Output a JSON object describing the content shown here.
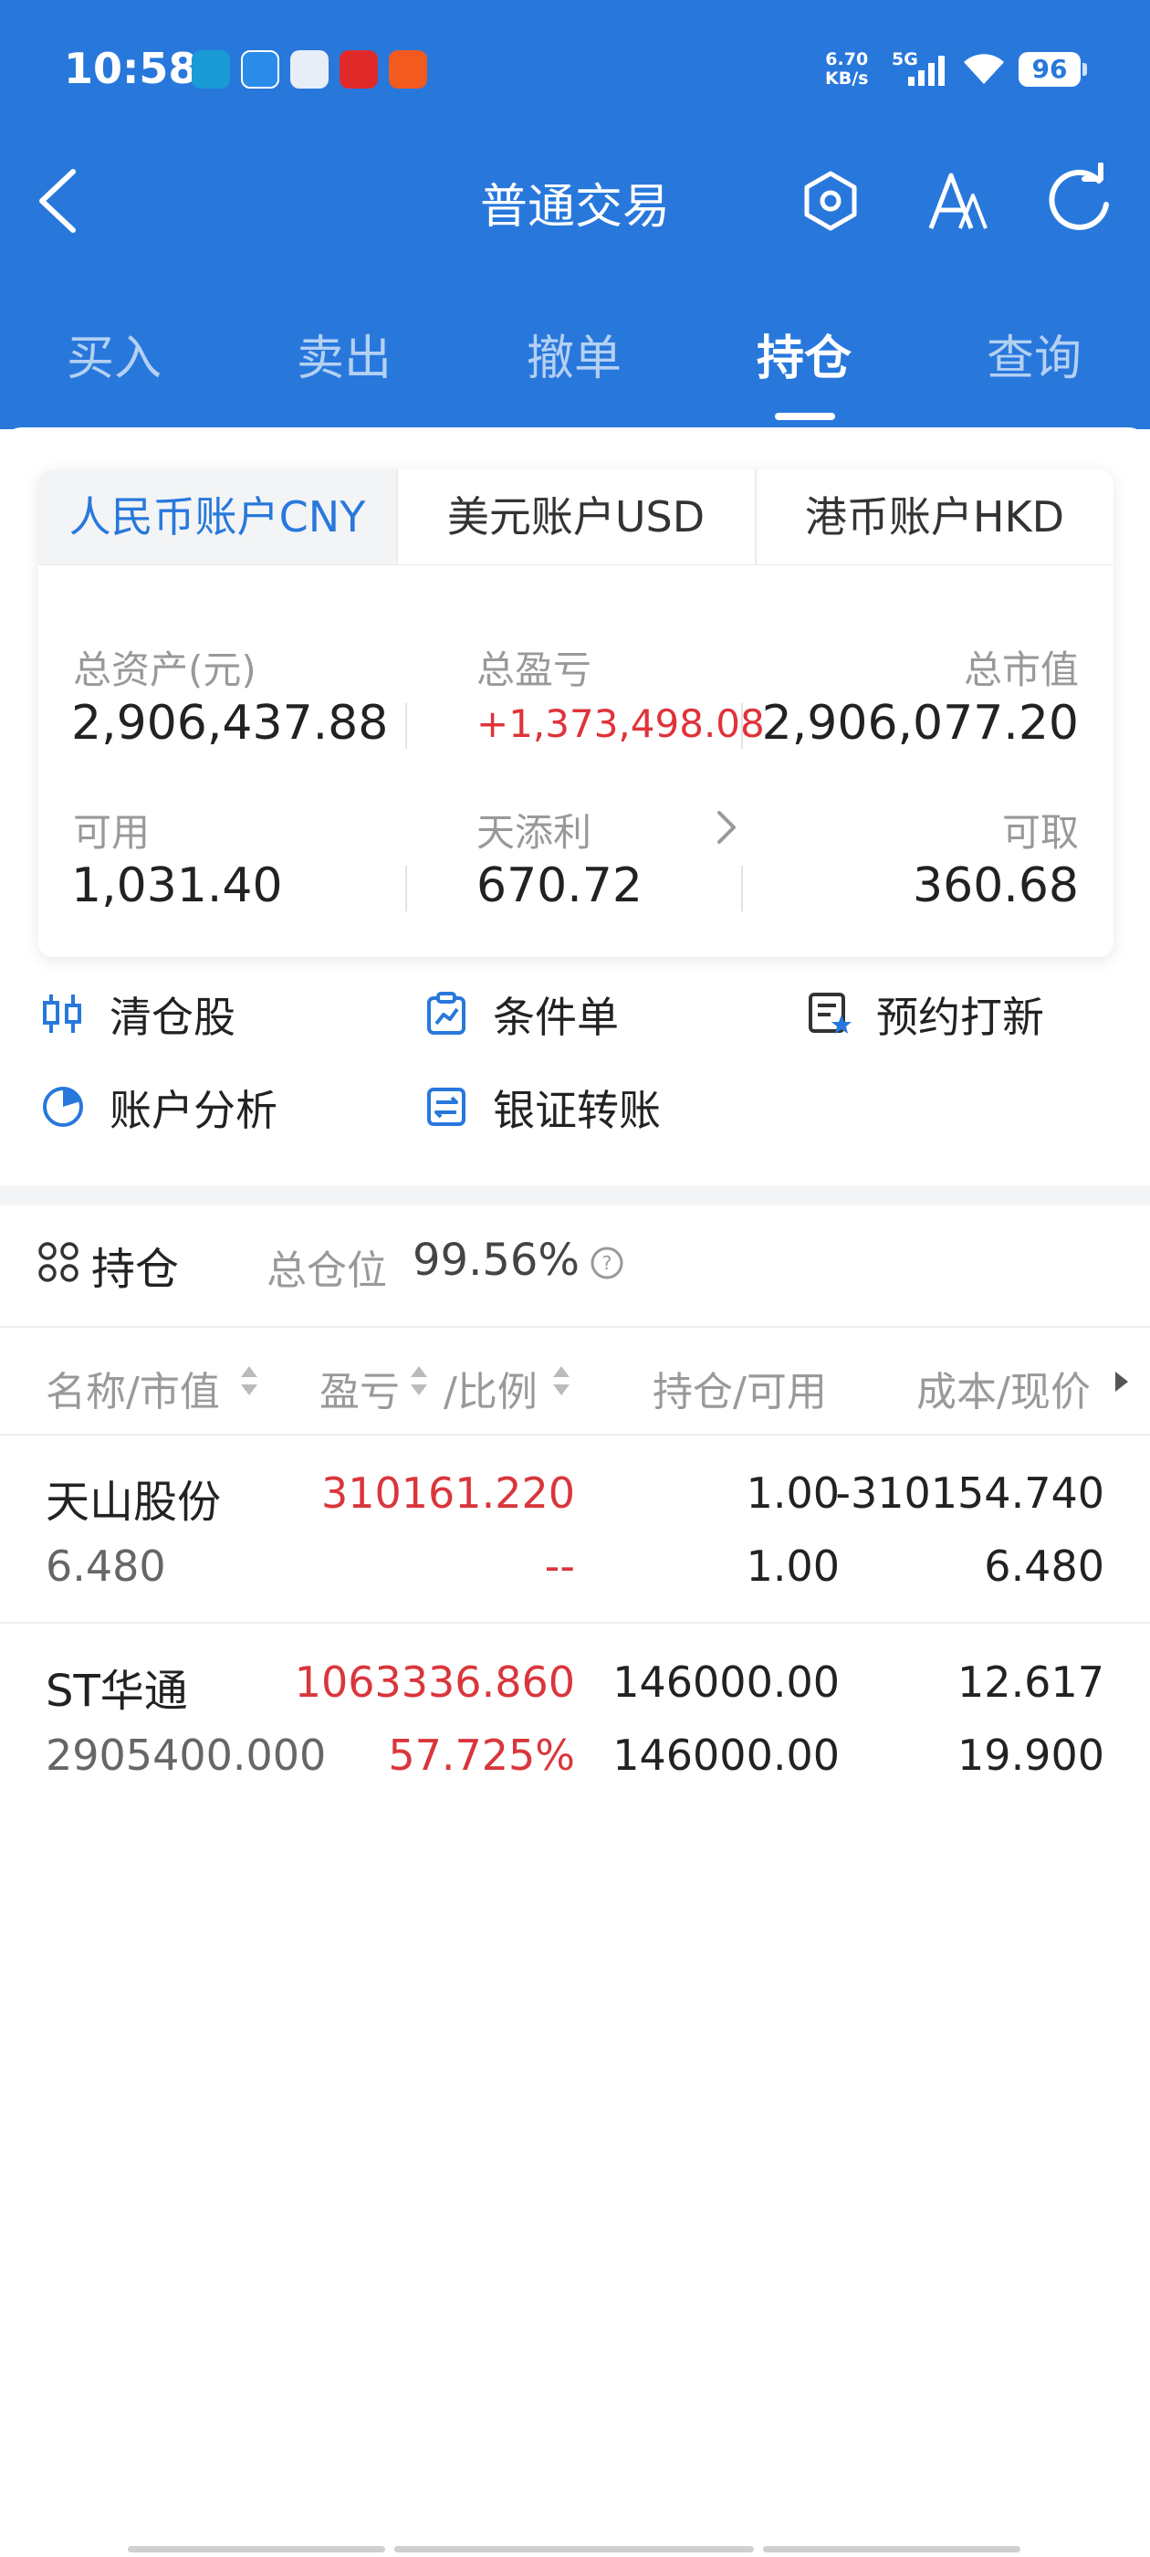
{
  "status_bar": {
    "time": "10:58",
    "net_speed_value": "6.70",
    "net_speed_unit": "KB/s",
    "network": "5G",
    "battery": "96"
  },
  "nav": {
    "title": "普通交易"
  },
  "tabs": [
    {
      "label": "买入"
    },
    {
      "label": "卖出"
    },
    {
      "label": "撤单"
    },
    {
      "label": "持仓"
    },
    {
      "label": "查询"
    }
  ],
  "account_tabs": [
    {
      "label": "人民币账户CNY"
    },
    {
      "label": "美元账户USD"
    },
    {
      "label": "港币账户HKD"
    }
  ],
  "summary": {
    "total_assets_label": "总资产(元)",
    "total_assets_value": "2,906,437.88",
    "total_pnl_label": "总盈亏",
    "total_pnl_value": "+1,373,498.08",
    "market_value_label": "总市值",
    "market_value_value": "2,906,077.20",
    "available_label": "可用",
    "available_value": "1,031.40",
    "tiantianli_label": "天添利",
    "tiantianli_value": "670.72",
    "withdrawable_label": "可取",
    "withdrawable_value": "360.68"
  },
  "quick_actions": [
    {
      "label": "清仓股"
    },
    {
      "label": "条件单"
    },
    {
      "label": "预约打新"
    },
    {
      "label": "账户分析"
    },
    {
      "label": "银证转账"
    }
  ],
  "holdings": {
    "title": "持仓",
    "position_ratio_label": "总仓位",
    "position_ratio_value": "99.56%",
    "columns": [
      "名称/市值",
      "盈亏",
      "/比例",
      "持仓/可用",
      "成本/现价"
    ],
    "rows": [
      {
        "name": "天山股份",
        "market_value": "6.480",
        "pnl": "310161.220",
        "pnl_ratio": "--",
        "holding": "1.00",
        "available": "1.00",
        "cost": "-310154.740",
        "price": "6.480"
      },
      {
        "name": "ST华通",
        "market_value": "2905400.000",
        "pnl": "1063336.860",
        "pnl_ratio": "57.725%",
        "holding": "146000.00",
        "available": "146000.00",
        "cost": "12.617",
        "price": "19.900"
      }
    ]
  },
  "colors": {
    "brand_blue": "#2878dc",
    "profit_red": "#d9363c"
  }
}
